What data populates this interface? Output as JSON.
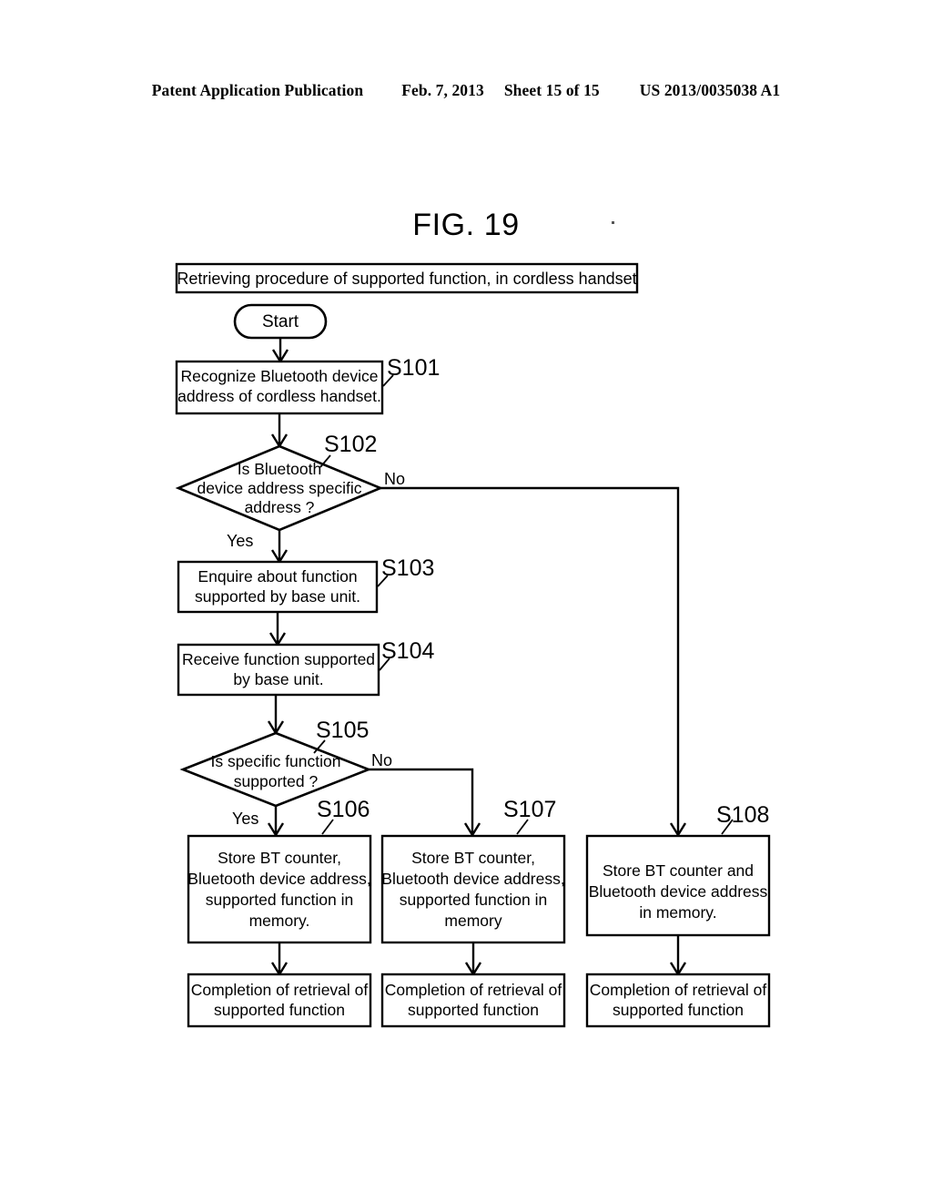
{
  "header": {
    "publication": "Patent Application Publication",
    "date": "Feb. 7, 2013",
    "sheet": "Sheet 15 of 15",
    "number": "US 2013/0035038 A1"
  },
  "figure": {
    "label": "FIG. 19",
    "title_box": "Retrieving procedure of supported function, in cordless handset"
  },
  "nodes": {
    "start": {
      "label": "Start"
    },
    "s101": {
      "step": "S101",
      "line1": "Recognize Bluetooth device",
      "line2": "address of cordless handset."
    },
    "s102": {
      "step": "S102",
      "line1": "Is Bluetooth",
      "line2": "device address specific",
      "line3": "address ?",
      "yes": "Yes",
      "no": "No"
    },
    "s103": {
      "step": "S103",
      "line1": "Enquire about function",
      "line2": "supported by base unit."
    },
    "s104": {
      "step": "S104",
      "line1": "Receive function supported",
      "line2": "by base unit."
    },
    "s105": {
      "step": "S105",
      "line1": "Is specific function",
      "line2": "supported ?",
      "yes": "Yes",
      "no": "No"
    },
    "s106": {
      "step": "S106",
      "line1": "Store BT counter,",
      "line2": "Bluetooth device address,",
      "line3": "supported function in",
      "line4": "memory."
    },
    "s107": {
      "step": "S107",
      "line1": "Store BT counter,",
      "line2": "Bluetooth device address,",
      "line3": "supported function in",
      "line4": "memory"
    },
    "s108": {
      "step": "S108",
      "line1": "Store BT counter and",
      "line2": "Bluetooth device address",
      "line3": "in memory."
    },
    "end_left": {
      "line1": "Completion of retrieval of",
      "line2": "supported function"
    },
    "end_middle": {
      "line1": "Completion of retrieval of",
      "line2": "supported function"
    },
    "end_right": {
      "line1": "Completion of retrieval of",
      "line2": "supported function"
    }
  },
  "colors": {
    "ink": "#000000",
    "paper": "#ffffff"
  }
}
